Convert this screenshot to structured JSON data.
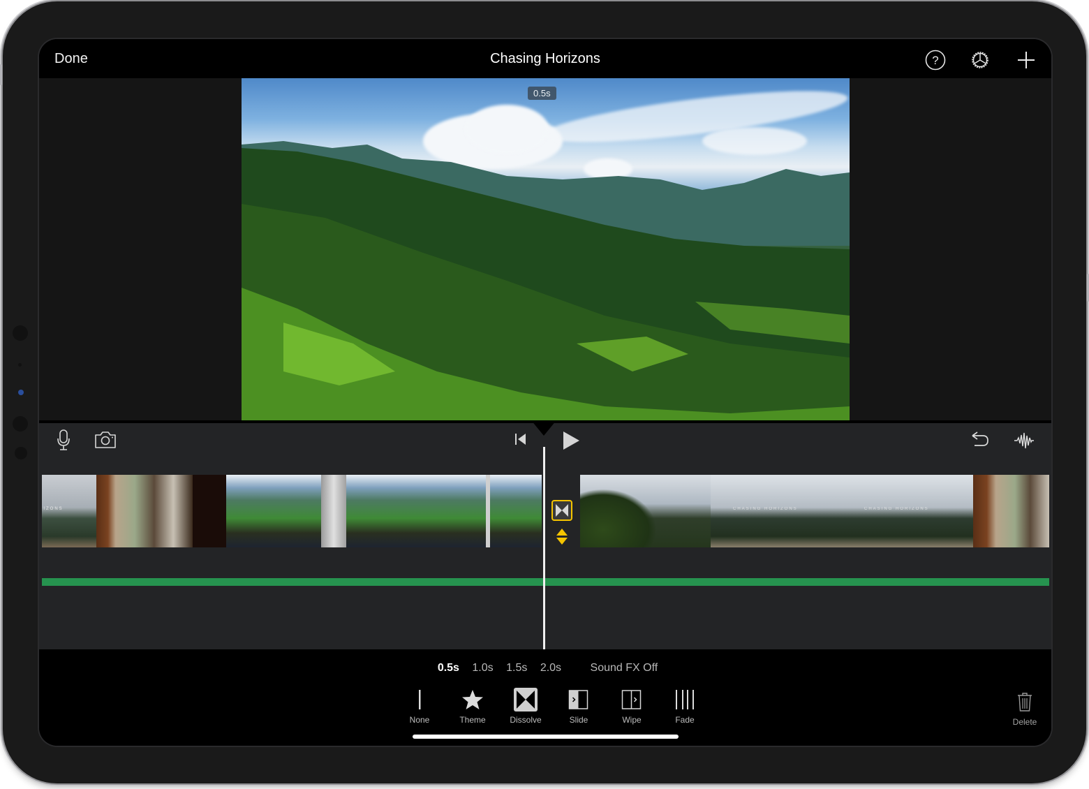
{
  "navbar": {
    "done_label": "Done",
    "title": "Chasing Horizons",
    "icons": [
      "help-icon",
      "settings-gear-icon",
      "add-plus-icon"
    ]
  },
  "viewer": {
    "duration_badge": "0.5s"
  },
  "timeline": {
    "left_tools": [
      "microphone-icon",
      "camera-icon"
    ],
    "center_tools": [
      "skip-to-start-icon",
      "play-icon"
    ],
    "right_tools": [
      "undo-icon",
      "audio-waveform-icon"
    ],
    "clips_before_transition": [
      {
        "name": "overlook-title-clip",
        "overlay_text": "RIZONS"
      },
      {
        "name": "restaurant-clip"
      },
      {
        "name": "dark-doorway-clip"
      },
      {
        "name": "hammock-clip-1"
      },
      {
        "name": "hammock-clip-2"
      }
    ],
    "clips_after_transition": [
      {
        "name": "plants-overlook-clip"
      },
      {
        "name": "river-overlook-clip-1",
        "overlay_text": "CHASING HORIZONS"
      },
      {
        "name": "river-overlook-clip-2",
        "overlay_text": "CHASING HORIZONS"
      },
      {
        "name": "restaurant-clip-2"
      }
    ],
    "transition_selected": "Dissolve",
    "accent_color": "#f5c400",
    "audio_track_color": "#26934f"
  },
  "panel": {
    "durations": [
      {
        "label": "0.5s",
        "selected": true
      },
      {
        "label": "1.0s",
        "selected": false
      },
      {
        "label": "1.5s",
        "selected": false
      },
      {
        "label": "2.0s",
        "selected": false
      }
    ],
    "sound_fx_label": "Sound FX Off",
    "transitions": [
      {
        "label": "None",
        "icon": "none-transition-icon"
      },
      {
        "label": "Theme",
        "icon": "star-icon"
      },
      {
        "label": "Dissolve",
        "icon": "dissolve-icon",
        "selected": true
      },
      {
        "label": "Slide",
        "icon": "slide-icon"
      },
      {
        "label": "Wipe",
        "icon": "wipe-icon"
      },
      {
        "label": "Fade",
        "icon": "fade-icon"
      }
    ],
    "delete_label": "Delete"
  }
}
